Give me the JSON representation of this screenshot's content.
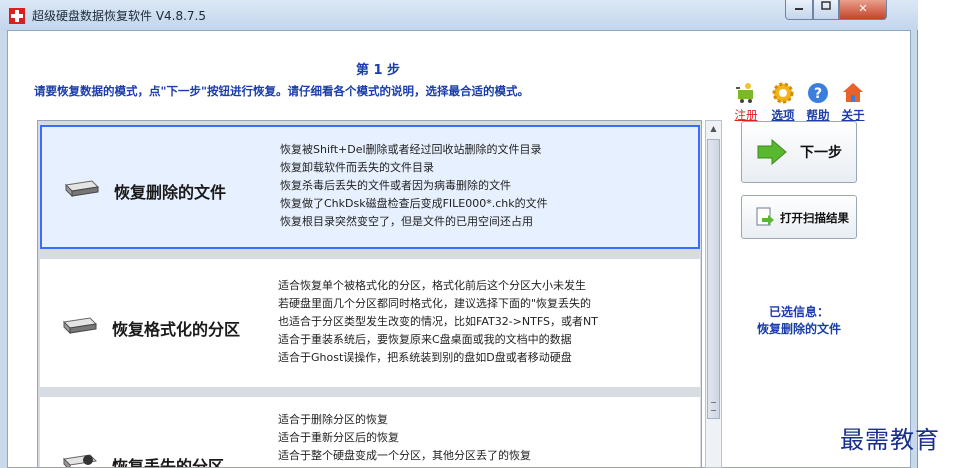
{
  "window": {
    "title": "超级硬盘数据恢复软件 V4.8.7.5",
    "close_label": "✕"
  },
  "header": {
    "step_title": "第 1 步",
    "instruction": "请要恢复数据的模式，点\"下一步\"按钮进行恢复。请仔细看各个模式的说明，选择最合适的模式。"
  },
  "toolbar": {
    "register": "注册",
    "options": "选项",
    "help": "帮助",
    "about": "关于"
  },
  "modes": [
    {
      "title": "恢复删除的文件",
      "selected": true,
      "lines": [
        "恢复被Shift+Del删除或者经过回收站删除的文件目录",
        "恢复卸载软件而丢失的文件目录",
        "恢复杀毒后丢失的文件或者因为病毒删除的文件",
        "恢复做了ChkDsk磁盘检查后变成FILE000*.chk的文件",
        "恢复根目录突然变空了，但是文件的已用空间还占用"
      ]
    },
    {
      "title": "恢复格式化的分区",
      "selected": false,
      "lines": [
        "适合恢复单个被格式化的分区，格式化前后这个分区大小未发生",
        "若硬盘里面几个分区都同时格式化，建议选择下面的\"恢复丢失的",
        "也适合于分区类型发生改变的情况，比如FAT32->NTFS，或者NT",
        "适合于重装系统后，要恢复原来C盘桌面或我的文档中的数据",
        "适合于Ghost误操作，把系统装到别的盘如D盘或者移动硬盘"
      ]
    },
    {
      "title": "恢复丢失的分区",
      "selected": false,
      "lines": [
        "适合于删除分区的恢复",
        "适合于重新分区后的恢复",
        "适合于整个硬盘变成一个分区，其他分区丢了的恢复"
      ]
    }
  ],
  "buttons": {
    "next": "下一步",
    "open_scan": "打开扫描结果"
  },
  "selection": {
    "label": "已选信息：",
    "value": "恢复删除的文件"
  },
  "watermark": "最需教育",
  "colors": {
    "accent_blue": "#1a3dab",
    "selected_border": "#3b6cff",
    "register_red": "#e02020"
  }
}
